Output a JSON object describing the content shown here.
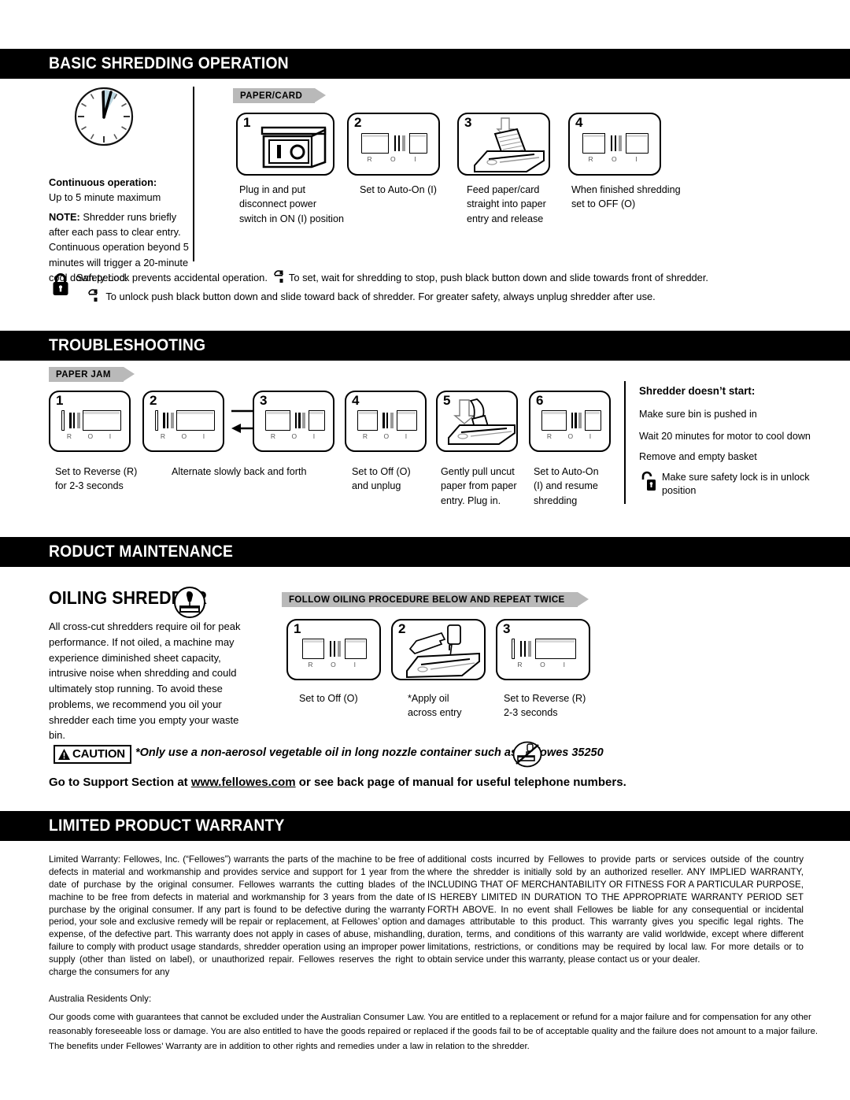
{
  "sections": {
    "basic": {
      "title": "BASIC SHREDDING OPERATION"
    },
    "troubleshooting": {
      "title": "TROUBLESHOOTING"
    },
    "maintenance": {
      "title": "RODUCT MAINTENANCE"
    },
    "warranty": {
      "title": "LIMITED PRODUCT WARRANTY"
    }
  },
  "basic": {
    "continuous_heading": "Continuous operation:",
    "continuous_value": "Up to 5 minute maximum",
    "note_label": "NOTE:",
    "note_text": " Shredder runs briefly after each pass to clear entry. Continuous operation beyond 5 minutes will trigger a 20-minute cool down period.",
    "tab_label": "PAPER/CARD",
    "steps": [
      {
        "num": "1",
        "caption": "Plug in and put\ndisconnect power\nswitch in ON (I) position",
        "icon": "power-switch-box-icon"
      },
      {
        "num": "2",
        "caption": "Set to Auto-On (I)",
        "icon": "rocker-switch-icon",
        "position": "right"
      },
      {
        "num": "3",
        "caption": "Feed paper/card\nstraight into paper\nentry and release",
        "icon": "feed-paper-icon"
      },
      {
        "num": "4",
        "caption": "When finished shredding\nset to OFF (O)",
        "icon": "rocker-switch-icon",
        "position": "center"
      }
    ],
    "safety_line1": "Safety Lock prevents accidental operation.",
    "safety_line1b": "To set, wait for shredding to stop, push black button down and slide towards front of shredder.",
    "safety_line2": "To unlock push black button down and slide toward back of shredder. For greater safety, always unplug shredder after use."
  },
  "troubleshooting": {
    "tab_label": "PAPER JAM",
    "steps": [
      {
        "num": "1",
        "caption": "Set to Reverse (R)\nfor 2-3 seconds",
        "icon": "rocker-switch-icon",
        "position": "left"
      },
      {
        "num": "2",
        "caption": "",
        "icon": "rocker-switch-icon",
        "position": "left"
      },
      {
        "num": "3",
        "caption": "",
        "icon": "rocker-switch-icon",
        "position": "right"
      },
      {
        "num": "4",
        "caption": "Set to Off (O)\nand unplug",
        "icon": "rocker-switch-icon",
        "position": "center"
      },
      {
        "num": "5",
        "caption": "Gently pull uncut\npaper from paper\nentry. Plug in.",
        "icon": "pull-paper-icon"
      },
      {
        "num": "6",
        "caption": "Set to Auto-On\n(I) and resume\nshredding",
        "icon": "rocker-switch-icon",
        "position": "right"
      }
    ],
    "alternate_caption": "Alternate slowly back and forth",
    "right_heading": "Shredder doesn’t start:",
    "right_items": [
      "Make sure bin is pushed in",
      "Wait 20 minutes for motor to cool down",
      "Remove and empty basket",
      "Make sure safety lock is in unlock\nposition"
    ]
  },
  "maintenance": {
    "oiling_heading": "OILING SHREDDER",
    "oiling_icon": "oil-bottle-icon",
    "oiling_body": "All cross-cut shredders require oil for peak performance. If not oiled, a machine may experience diminished sheet capacity, intrusive noise when shredding and could ultimately stop running. To avoid these problems, we recommend you oil your shredder each time you empty your waste bin.",
    "tab_label": "FOLLOW OILING PROCEDURE BELOW AND REPEAT TWICE",
    "steps": [
      {
        "num": "1",
        "caption": "Set to Off (O)",
        "icon": "rocker-switch-icon",
        "position": "center"
      },
      {
        "num": "2",
        "caption": "*Apply oil\nacross entry",
        "icon": "apply-oil-icon"
      },
      {
        "num": "3",
        "caption": "Set to Reverse (R)\n2-3 seconds",
        "icon": "rocker-switch-icon",
        "position": "left"
      }
    ],
    "caution_label": "CAUTION",
    "caution_text": "*Only use a non-aerosol vegetable oil in long nozzle container such as Fellowes 35250",
    "no_aerosol_icon": "no-aerosol-spray-icon",
    "support_pre": "Go to Support Section at ",
    "support_url": "www.fellowes.com",
    "support_post": " or see back page of manual for useful telephone numbers."
  },
  "warranty": {
    "col_left": "Limited Warranty:  Fellowes, Inc. (“Fellowes”) warrants the parts of the machine to be free of defects in material and workmanship and provides service and support for 1 year from the date of purchase by the original consumer.  Fellowes warrants the cutting blades of the machine to be free from defects in material and workmanship for 3 years from the date of purchase by the original consumer. If any part is found to be defective during the warranty period, your sole and exclusive remedy will be repair or replacement, at Fellowes’ option and expense, of the defective part. This warranty does not apply in cases of abuse, mishandling, failure to comply with product usage standards, shredder operation using an improper power supply (other than listed on label), or unauthorized repair. Fellowes reserves the right to charge the consumers for any",
    "col_right": "additional costs incurred by Fellowes to provide parts or services outside of the country where the shredder is initially sold by an authorized reseller. ANY IMPLIED WARRANTY, INCLUDING THAT OF MERCHANTABILITY OR FITNESS FOR A PARTICULAR PURPOSE, IS HEREBY LIMITED IN DURATION TO THE APPROPRIATE WARRANTY PERIOD SET FORTH ABOVE. In no event shall Fellowes be liable for any consequential or incidental damages attributable to this product. This warranty gives you specific legal rights. The duration, terms, and conditions of this warranty are valid worldwide, except where different limitations, restrictions, or conditions may be required by local law. For more details or to obtain service under this warranty, please contact us or your dealer.",
    "australia_heading": "Australia Residents Only:",
    "australia_body": "Our goods come with guarantees that cannot be excluded under the Australian Consumer Law. You are entitled to a replacement or refund for a major failure and for compensation for any other reasonably foreseeable loss or damage. You are also entitled to have the goods repaired or replaced if the goods fail to be of acceptable quality and the failure does not amount to a major failure. The benefits under Fellowes’ Warranty are in addition to other rights and remedies under a law in relation to the shredder."
  },
  "switch_labels": {
    "left": "R",
    "center": "O",
    "right": "I"
  },
  "colors": {
    "bar_bg": "#000000",
    "bar_fg": "#ffffff",
    "tab_bg": "#b9b9b9",
    "clock_accent": "#bcd6e0"
  }
}
